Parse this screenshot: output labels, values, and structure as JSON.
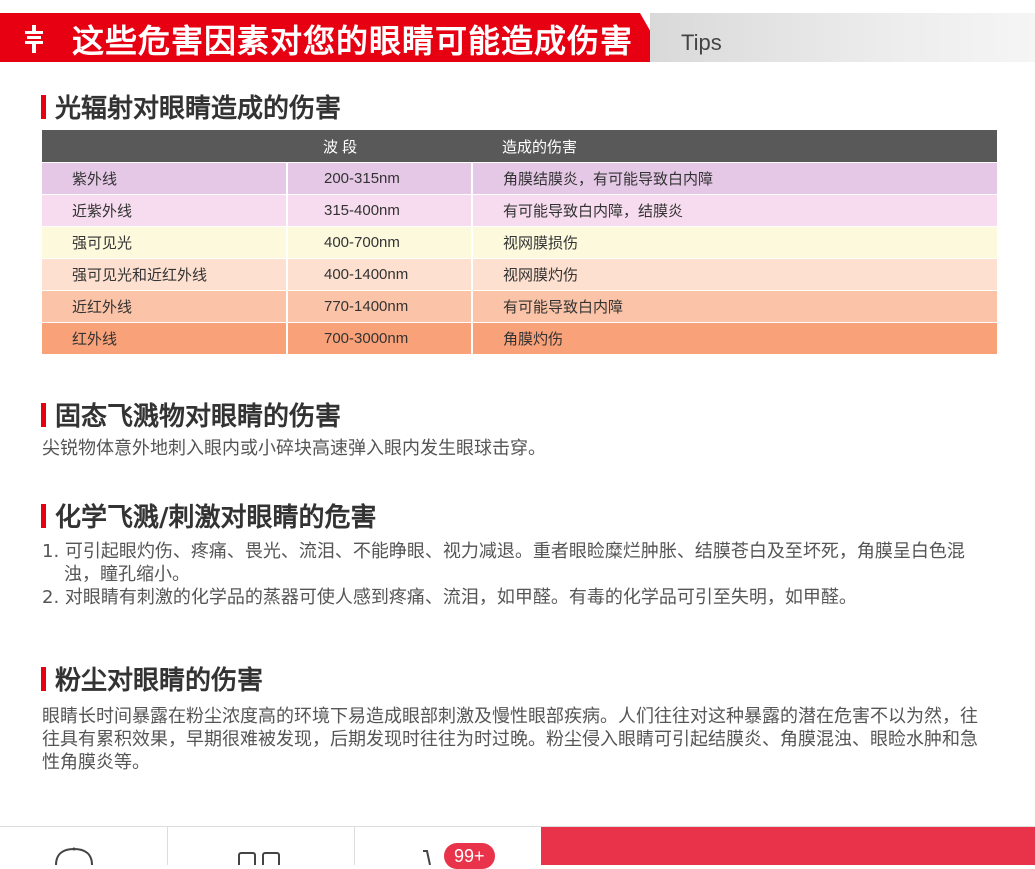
{
  "banner": {
    "title": "这些危害因素对您的眼睛可能造成伤害",
    "tips": "Tips",
    "accent": "#e60012"
  },
  "sections": {
    "light": {
      "title": "光辐射对眼睛造成的伤害"
    },
    "solid": {
      "title": "固态飞溅物对眼睛的伤害",
      "body": "尖锐物体意外地刺入眼内或小碎块高速弹入眼内发生眼球击穿。"
    },
    "chemical": {
      "title": "化学飞溅/刺激对眼睛的危害",
      "items": [
        "1. 可引起眼灼伤、疼痛、畏光、流泪、不能睁眼、视力减退。重者眼睑糜烂肿胀、结膜苍白及至坏死，角膜呈白色混浊，瞳孔缩小。",
        "2. 对眼睛有刺激的化学品的蒸器可使人感到疼痛、流泪，如甲醛。有毒的化学品可引至失明，如甲醛。"
      ]
    },
    "dust": {
      "title": "粉尘对眼睛的伤害",
      "body": "眼睛长时间暴露在粉尘浓度高的环境下易造成眼部刺激及慢性眼部疾病。人们往往对这种暴露的潜在危害不以为然，往往具有累积效果，早期很难被发现，后期发现时往往为时过晚。粉尘侵入眼睛可引起结膜炎、角膜混浊、眼睑水肿和急性角膜炎等。"
    }
  },
  "table": {
    "headers": [
      "",
      "波 段",
      "造成的伤害"
    ],
    "header_color": "#595959",
    "rows": [
      {
        "name": "紫外线",
        "band": "200-315nm",
        "harm": "角膜结膜炎，有可能导致白内障",
        "color": "#e5c8e6"
      },
      {
        "name": "近紫外线",
        "band": "315-400nm",
        "harm": "有可能导致白内障，结膜炎",
        "color": "#f6dcee"
      },
      {
        "name": "强可见光",
        "band": "400-700nm",
        "harm": "视网膜损伤",
        "color": "#fdf9dd"
      },
      {
        "name": "强可见光和近红外线",
        "band": "400-1400nm",
        "harm": "视网膜灼伤",
        "color": "#fde0cf"
      },
      {
        "name": "近红外线",
        "band": "770-1400nm",
        "harm": "有可能导致白内障",
        "color": "#fbc4a8"
      },
      {
        "name": "红外线",
        "band": "700-3000nm",
        "harm": "角膜灼伤",
        "color": "#f9a27a"
      }
    ]
  },
  "bottom_nav": {
    "cart_badge": "99+",
    "cta_color": "#e8334a"
  }
}
